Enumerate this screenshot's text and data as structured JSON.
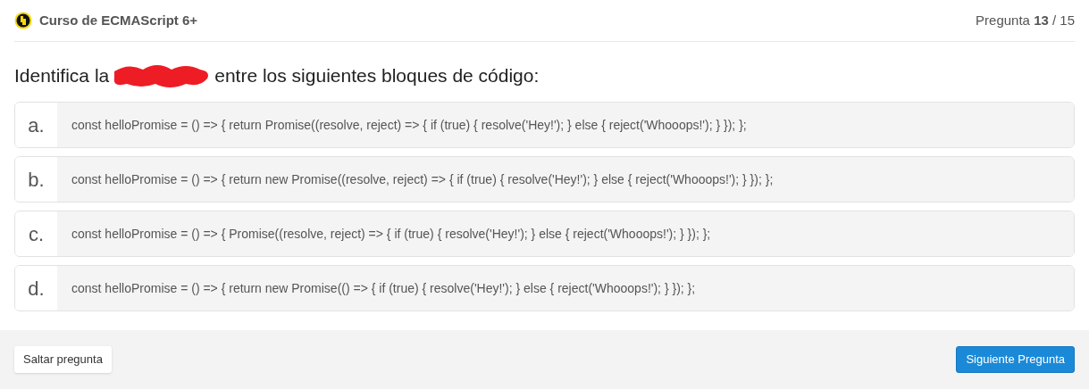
{
  "header": {
    "course": "Curso de ECMAScript 6+",
    "counter": "Pregunta **13** / 15"
  },
  "question": {
    "before": "Identifica la",
    "after": "entre los siguientes bloques de código:"
  },
  "options": [
    {
      "letter": "a.",
      "code": "const helloPromise = () => { return Promise((resolve, reject) => { if (true) { resolve('Hey!'); } else { reject('Whooops!'); } }); };",
      "selected": false
    },
    {
      "letter": "b.",
      "code": "const helloPromise = () => { return new Promise((resolve, reject) => { if (true) { resolve('Hey!'); } else { reject('Whooops!'); } }); };",
      "selected": false
    },
    {
      "letter": "c.",
      "code": "const helloPromise = () => { Promise((resolve, reject) => { if (true) { resolve('Hey!'); } else { reject('Whooops!'); } }); };",
      "selected": false
    },
    {
      "letter": "d.",
      "code": "const helloPromise = () => { return new Promise(() => { if (true) { resolve('Hey!'); } else { reject('Whooops!'); } }); };",
      "selected": false
    }
  ],
  "footer": {
    "skip": "Saltar pregunta",
    "next": "Siguiente Pregunta"
  }
}
